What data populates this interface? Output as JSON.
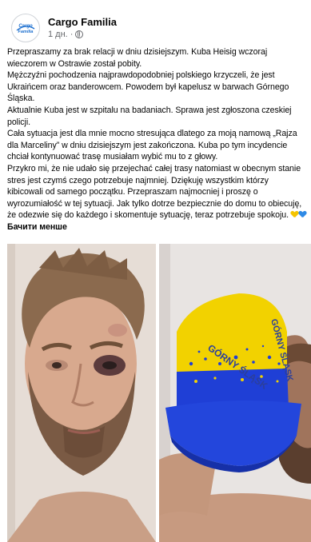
{
  "post": {
    "author": "Cargo Familia",
    "time": "1 дн.",
    "time_sep": "·",
    "avatar_text": "Cargo Familia",
    "paragraphs": [
      "Przepraszamy za brak relacji w dniu dzisiejszym. Kuba Heisig wczoraj wieczorem w Ostrawie został pobity.",
      "Mężczyźni pochodzenia najprawdopodobniej polskiego krzyczeli, że jest Ukraińcem oraz banderowcem. Powodem był kapelusz w barwach Górnego Śląska.",
      "Aktualnie Kuba jest w szpitalu na badaniach. Sprawa jest zgłoszona czeskiej policji.",
      "Cała sytuacja jest dla mnie mocno stresująca dlatego za moją namową „Rajza dla Marceliny” w dniu dzisiejszym jest zakończona. Kuba po tym incydencie chciał kontynuować trasę musiałam wybić mu to z głowy.",
      "Przykro mi, że nie udało się przejechać całej trasy natomiast w obecnym stanie stres jest czymś czego potrzebuje najmniej. Dziękuję wszystkim którzy kibicowali od samego początku. Przepraszam najmocniej i proszę o wyrozumiałość w tej sytuacji. Jak tylko dotrze bezpiecznie do domu to obiecuję, że odezwie się do każdego i skomentuje sytuację, teraz potrzebuje spokoju."
    ],
    "see_less": "Бачити менше",
    "hat_text_1": "GÓRNY ŚLĄSK",
    "hat_text_2": "GÓRNY ŚLĄSK"
  },
  "colors": {
    "text": "#050505",
    "secondary": "#65676b",
    "hat_yellow": "#f2d200",
    "hat_blue": "#1f3fd6"
  }
}
